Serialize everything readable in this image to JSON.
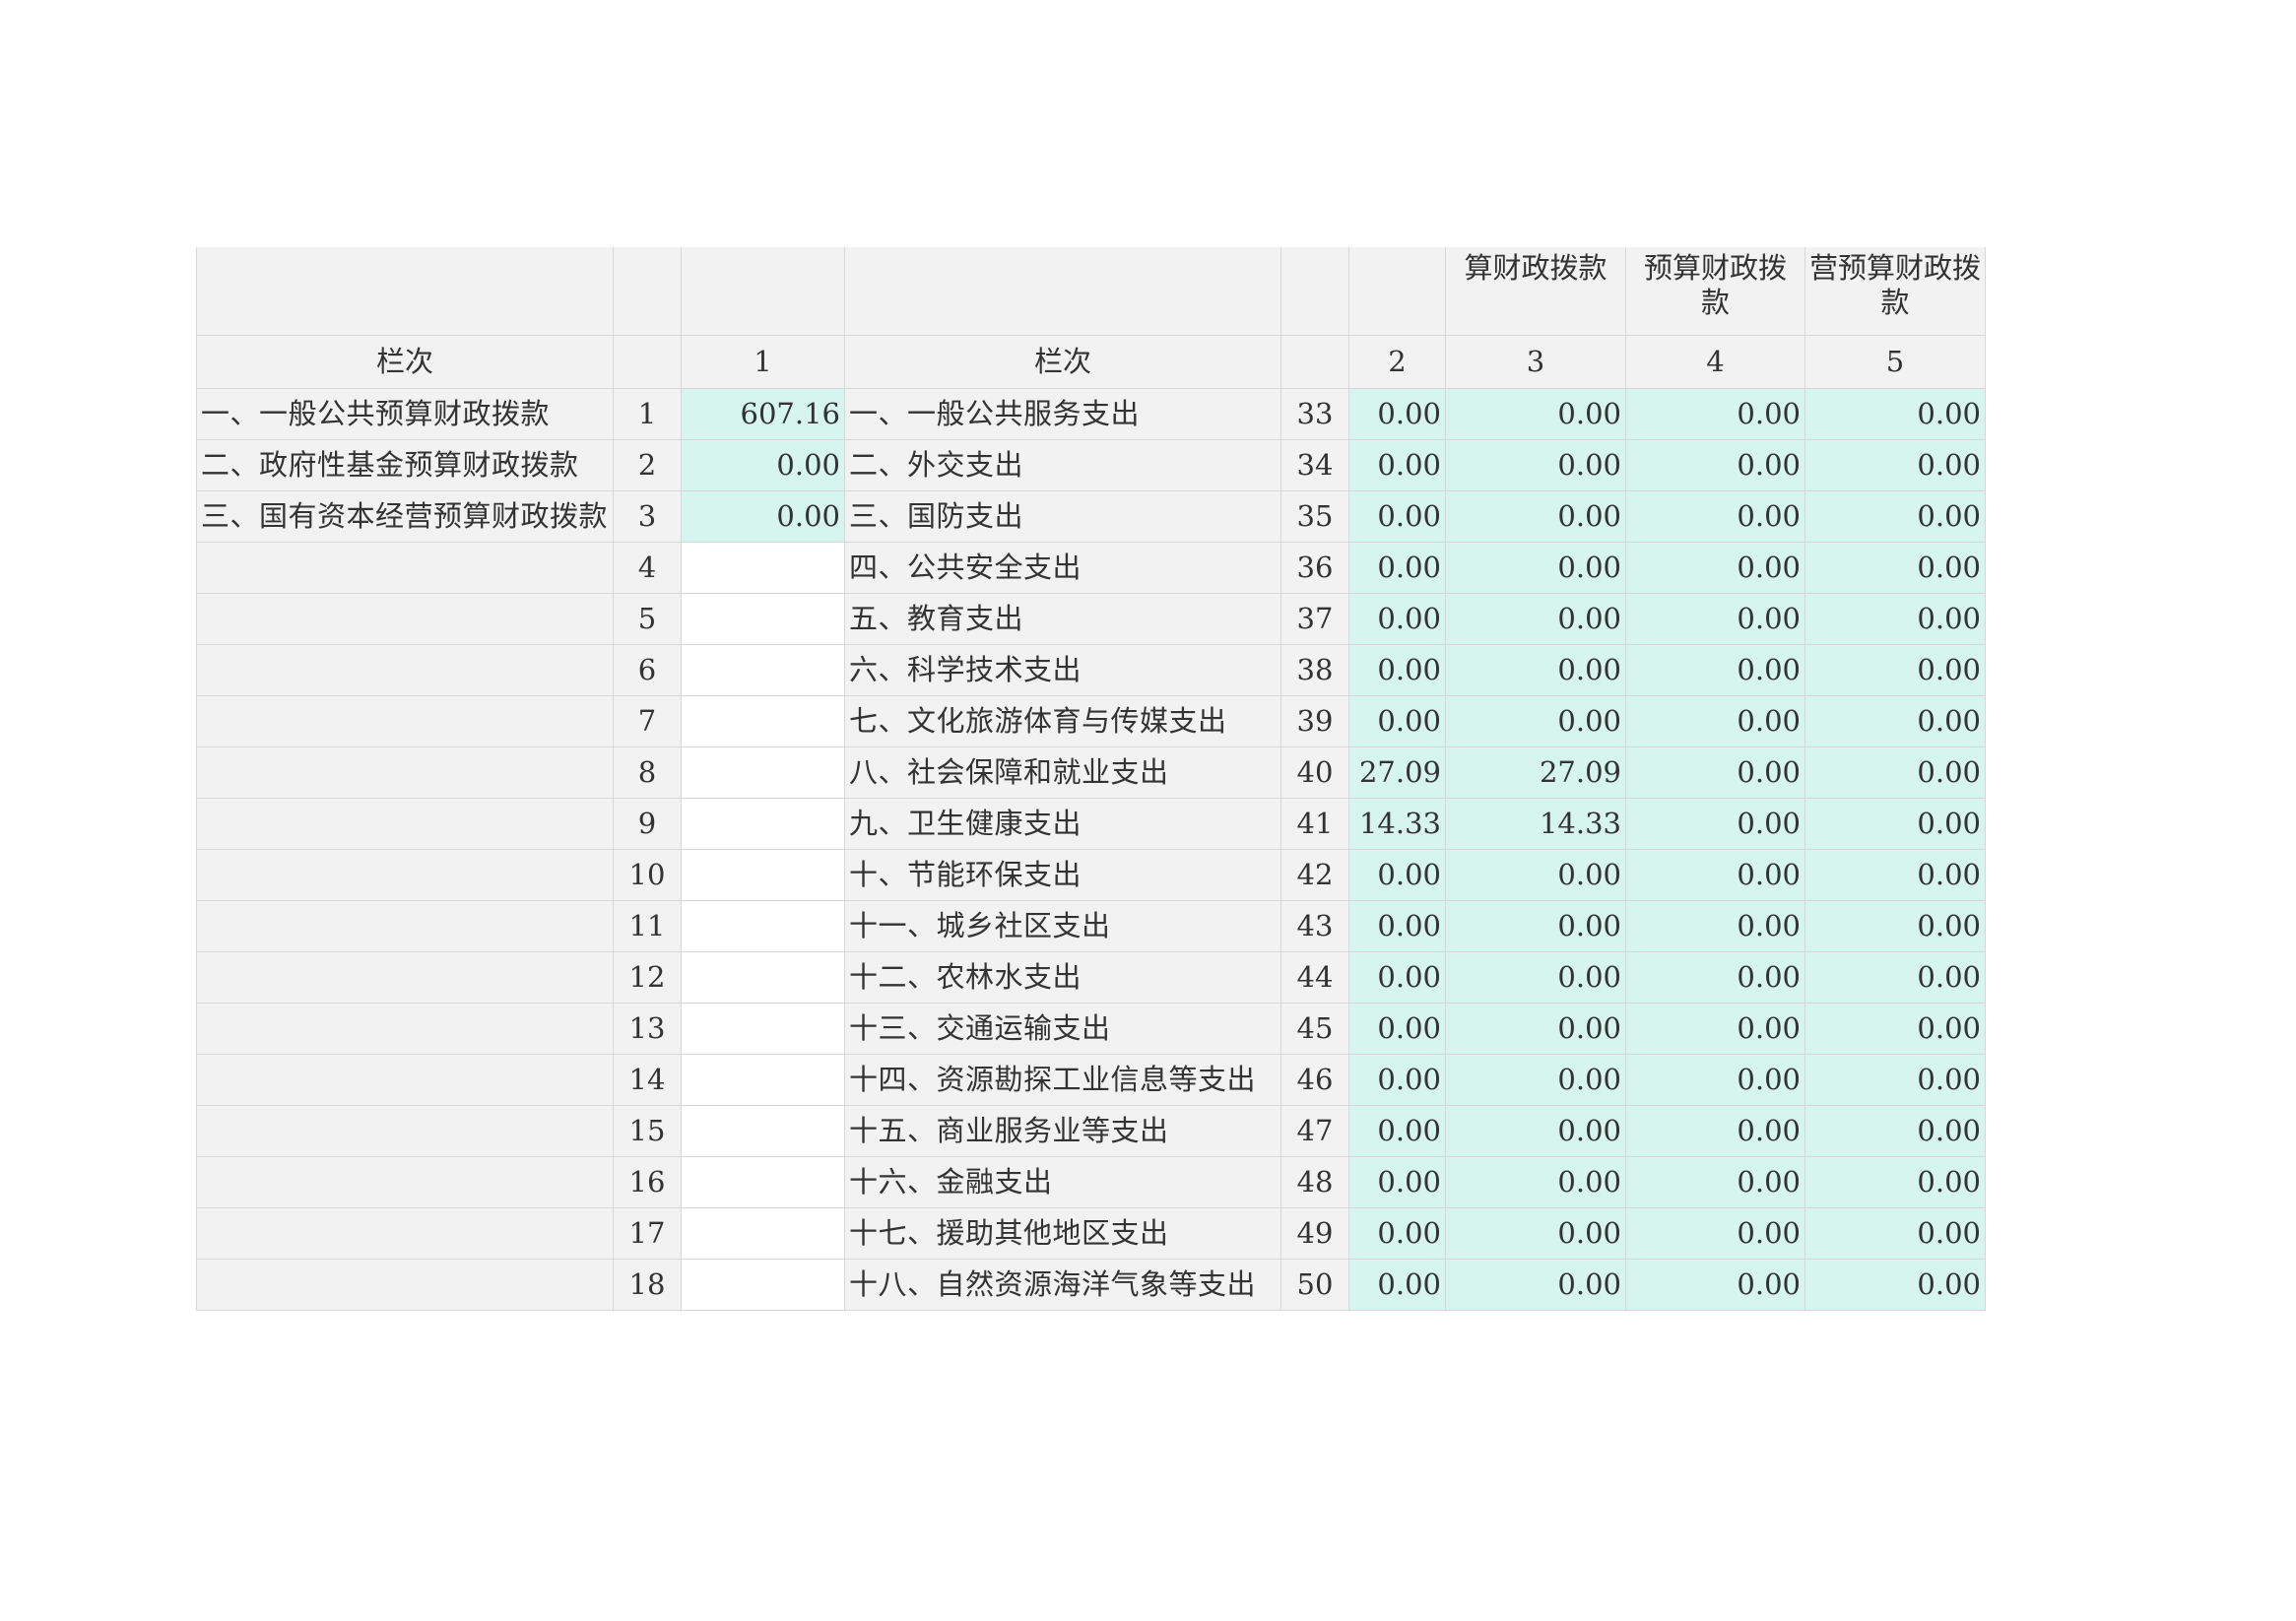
{
  "header": {
    "col_headers_top": [
      "",
      "",
      "",
      "",
      "",
      "",
      "算财政拨款",
      "预算财政拨款",
      "营预算财政拨款"
    ],
    "colnum": {
      "left_label": "栏次",
      "c1": "1",
      "right_label": "栏次",
      "c2": "2",
      "c3": "3",
      "c4": "4",
      "c5": "5"
    }
  },
  "rows": [
    {
      "income_label": "一、一般公共预算财政拨款",
      "idx": "1",
      "income_value": "607.16",
      "expense_label": "一、一般公共服务支出",
      "code": "33",
      "v2": "0.00",
      "v3": "0.00",
      "v4": "0.00",
      "v5": "0.00"
    },
    {
      "income_label": "二、政府性基金预算财政拨款",
      "idx": "2",
      "income_value": "0.00",
      "expense_label": "二、外交支出",
      "code": "34",
      "v2": "0.00",
      "v3": "0.00",
      "v4": "0.00",
      "v5": "0.00"
    },
    {
      "income_label": "三、国有资本经营预算财政拨款",
      "idx": "3",
      "income_value": "0.00",
      "expense_label": "三、国防支出",
      "code": "35",
      "v2": "0.00",
      "v3": "0.00",
      "v4": "0.00",
      "v5": "0.00"
    },
    {
      "income_label": "",
      "idx": "4",
      "income_value": "",
      "expense_label": "四、公共安全支出",
      "code": "36",
      "v2": "0.00",
      "v3": "0.00",
      "v4": "0.00",
      "v5": "0.00"
    },
    {
      "income_label": "",
      "idx": "5",
      "income_value": "",
      "expense_label": "五、教育支出",
      "code": "37",
      "v2": "0.00",
      "v3": "0.00",
      "v4": "0.00",
      "v5": "0.00"
    },
    {
      "income_label": "",
      "idx": "6",
      "income_value": "",
      "expense_label": "六、科学技术支出",
      "code": "38",
      "v2": "0.00",
      "v3": "0.00",
      "v4": "0.00",
      "v5": "0.00"
    },
    {
      "income_label": "",
      "idx": "7",
      "income_value": "",
      "expense_label": "七、文化旅游体育与传媒支出",
      "code": "39",
      "v2": "0.00",
      "v3": "0.00",
      "v4": "0.00",
      "v5": "0.00"
    },
    {
      "income_label": "",
      "idx": "8",
      "income_value": "",
      "expense_label": "八、社会保障和就业支出",
      "code": "40",
      "v2": "27.09",
      "v3": "27.09",
      "v4": "0.00",
      "v5": "0.00"
    },
    {
      "income_label": "",
      "idx": "9",
      "income_value": "",
      "expense_label": "九、卫生健康支出",
      "code": "41",
      "v2": "14.33",
      "v3": "14.33",
      "v4": "0.00",
      "v5": "0.00"
    },
    {
      "income_label": "",
      "idx": "10",
      "income_value": "",
      "expense_label": "十、节能环保支出",
      "code": "42",
      "v2": "0.00",
      "v3": "0.00",
      "v4": "0.00",
      "v5": "0.00"
    },
    {
      "income_label": "",
      "idx": "11",
      "income_value": "",
      "expense_label": "十一、城乡社区支出",
      "code": "43",
      "v2": "0.00",
      "v3": "0.00",
      "v4": "0.00",
      "v5": "0.00"
    },
    {
      "income_label": "",
      "idx": "12",
      "income_value": "",
      "expense_label": "十二、农林水支出",
      "code": "44",
      "v2": "0.00",
      "v3": "0.00",
      "v4": "0.00",
      "v5": "0.00"
    },
    {
      "income_label": "",
      "idx": "13",
      "income_value": "",
      "expense_label": "十三、交通运输支出",
      "code": "45",
      "v2": "0.00",
      "v3": "0.00",
      "v4": "0.00",
      "v5": "0.00"
    },
    {
      "income_label": "",
      "idx": "14",
      "income_value": "",
      "expense_label": "十四、资源勘探工业信息等支出",
      "code": "46",
      "v2": "0.00",
      "v3": "0.00",
      "v4": "0.00",
      "v5": "0.00"
    },
    {
      "income_label": "",
      "idx": "15",
      "income_value": "",
      "expense_label": "十五、商业服务业等支出",
      "code": "47",
      "v2": "0.00",
      "v3": "0.00",
      "v4": "0.00",
      "v5": "0.00"
    },
    {
      "income_label": "",
      "idx": "16",
      "income_value": "",
      "expense_label": "十六、金融支出",
      "code": "48",
      "v2": "0.00",
      "v3": "0.00",
      "v4": "0.00",
      "v5": "0.00"
    },
    {
      "income_label": "",
      "idx": "17",
      "income_value": "",
      "expense_label": "十七、援助其他地区支出",
      "code": "49",
      "v2": "0.00",
      "v3": "0.00",
      "v4": "0.00",
      "v5": "0.00"
    },
    {
      "income_label": "",
      "idx": "18",
      "income_value": "",
      "expense_label": "十八、自然资源海洋气象等支出",
      "code": "50",
      "v2": "0.00",
      "v3": "0.00",
      "v4": "0.00",
      "v5": "0.00"
    }
  ],
  "colors": {
    "input_cell": "#d6f5ee",
    "label_cell": "#f2f2f2",
    "empty_cell": "#ffffff",
    "grid": "#d7d7d7"
  }
}
